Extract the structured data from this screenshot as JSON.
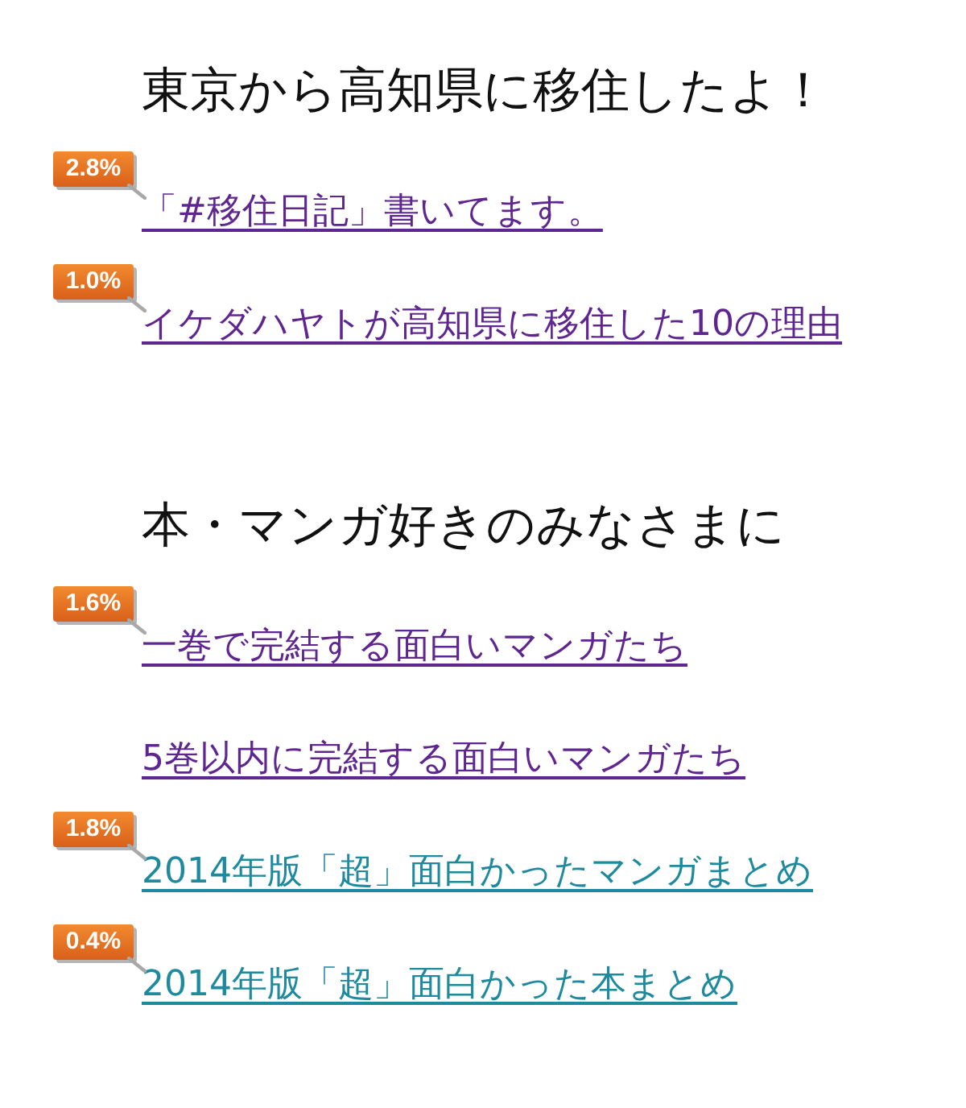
{
  "sections": [
    {
      "heading": "東京から高知県に移住したよ！",
      "links": [
        {
          "text": "「#移住日記」書いてます。",
          "visited": true,
          "badge": "2.8%"
        },
        {
          "text": "イケダハヤトが高知県に移住した10の理由",
          "visited": true,
          "badge": "1.0%"
        }
      ]
    },
    {
      "heading": "本・マンガ好きのみなさまに",
      "links": [
        {
          "text": "一巻で完結する面白いマンガたち",
          "visited": true,
          "badge": "1.6%"
        },
        {
          "text": "5巻以内に完結する面白いマンガたち",
          "visited": true
        },
        {
          "text": "2014年版「超」面白かったマンガまとめ",
          "visited": false,
          "badge": "1.8%"
        },
        {
          "text": "2014年版「超」面白かった本まとめ",
          "visited": false,
          "badge": "0.4%"
        }
      ]
    }
  ]
}
